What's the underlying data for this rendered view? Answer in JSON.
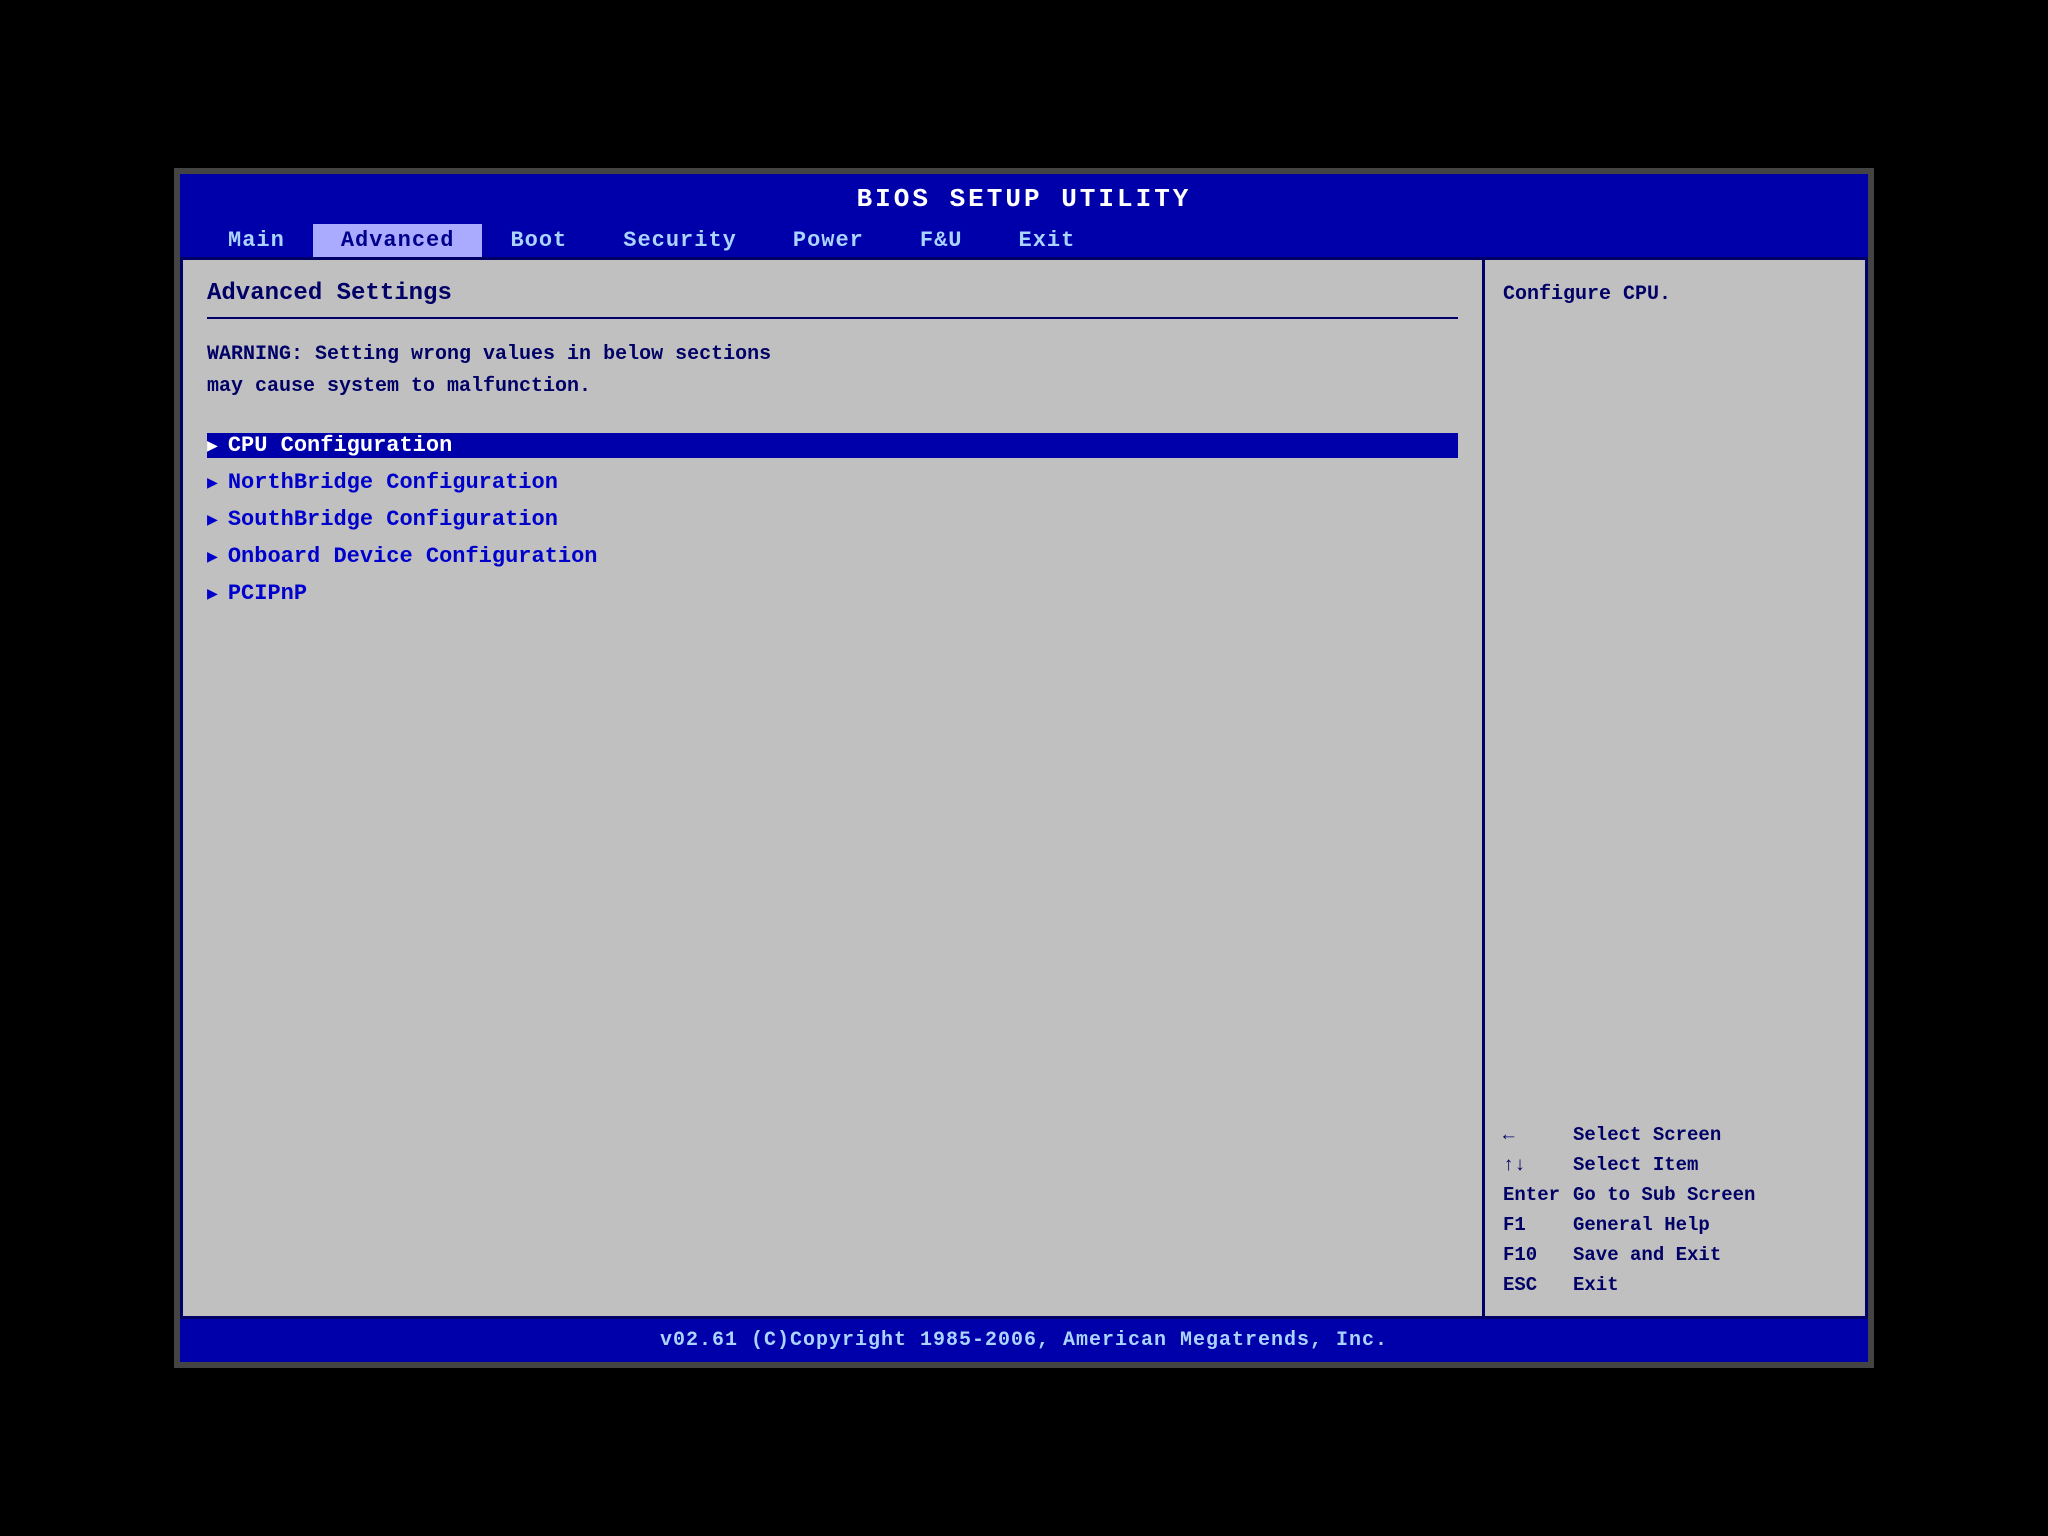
{
  "title": "BIOS SETUP UTILITY",
  "nav": {
    "items": [
      {
        "label": "Main",
        "active": false
      },
      {
        "label": "Advanced",
        "active": true
      },
      {
        "label": "Boot",
        "active": false
      },
      {
        "label": "Security",
        "active": false
      },
      {
        "label": "Power",
        "active": false
      },
      {
        "label": "F&U",
        "active": false
      },
      {
        "label": "Exit",
        "active": false
      }
    ]
  },
  "left_panel": {
    "section_title": "Advanced Settings",
    "warning_line1": "WARNING: Setting wrong values in below sections",
    "warning_line2": "may cause system to malfunction.",
    "menu_items": [
      {
        "label": "CPU Configuration",
        "selected": true
      },
      {
        "label": "NorthBridge Configuration",
        "selected": false
      },
      {
        "label": "SouthBridge Configuration",
        "selected": false
      },
      {
        "label": "Onboard Device Configuration",
        "selected": false
      },
      {
        "label": "PCIPnP",
        "selected": false
      }
    ]
  },
  "right_panel": {
    "help_text": "Configure CPU.",
    "key_bindings": [
      {
        "key": "←",
        "desc": "Select Screen"
      },
      {
        "key": "↑↓",
        "desc": "Select Item"
      },
      {
        "key": "Enter",
        "desc": "Go to Sub Screen"
      },
      {
        "key": "F1",
        "desc": "General Help"
      },
      {
        "key": "F10",
        "desc": "Save and Exit"
      },
      {
        "key": "ESC",
        "desc": "Exit"
      }
    ]
  },
  "footer": "v02.61 (C)Copyright 1985-2006, American Megatrends, Inc."
}
